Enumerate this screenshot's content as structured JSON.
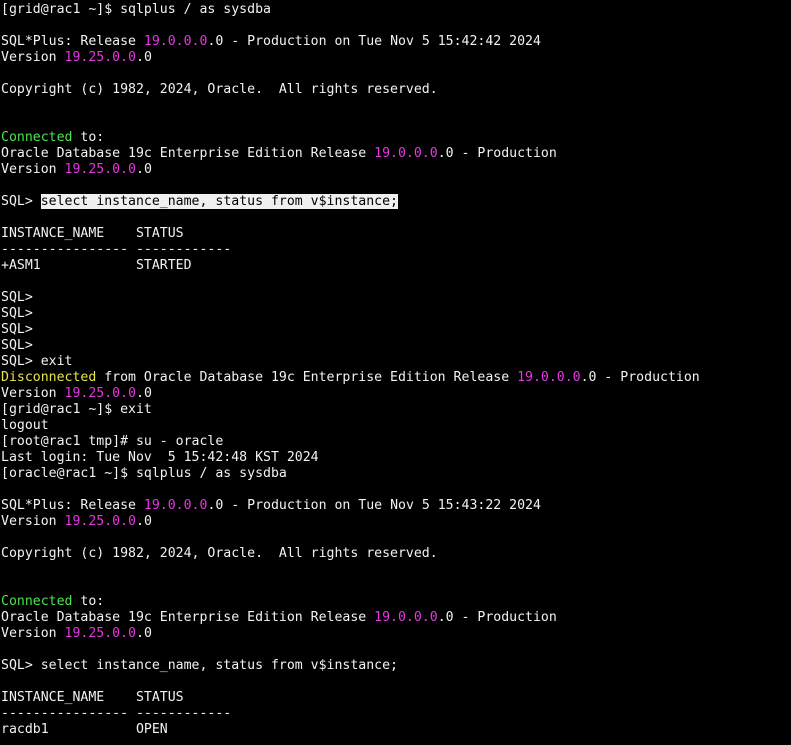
{
  "colors": {
    "background": "#000000",
    "foreground": "#f2f2f2",
    "number": "#e535e5",
    "connected": "#4fe34f",
    "disconnected": "#e6e64a",
    "selection_bg": "#f0f0f0",
    "selection_fg": "#000000"
  },
  "terminal": {
    "lines": [
      [
        {
          "t": "[grid@rac1 ~]$ sqlplus / as sysdba"
        }
      ],
      [],
      [
        {
          "t": "SQL*Plus: Release "
        },
        {
          "t": "19.0.0.0",
          "c": "number"
        },
        {
          "t": ".0 - Production on Tue Nov 5 15:42:42 2024"
        }
      ],
      [
        {
          "t": "Version "
        },
        {
          "t": "19.25.0.0",
          "c": "number"
        },
        {
          "t": ".0"
        }
      ],
      [],
      [
        {
          "t": "Copyright (c) 1982, 2024, Oracle.  All rights reserved."
        }
      ],
      [],
      [],
      [
        {
          "t": "Connected",
          "c": "connected"
        },
        {
          "t": " to:"
        }
      ],
      [
        {
          "t": "Oracle Database 19c Enterprise Edition Release "
        },
        {
          "t": "19.0.0.0",
          "c": "number"
        },
        {
          "t": ".0 - Production"
        }
      ],
      [
        {
          "t": "Version "
        },
        {
          "t": "19.25.0.0",
          "c": "number"
        },
        {
          "t": ".0"
        }
      ],
      [],
      [
        {
          "t": "SQL> "
        },
        {
          "t": "select instance_name, status from v$instance;",
          "c": "selected"
        }
      ],
      [],
      [
        {
          "t": "INSTANCE_NAME    STATUS"
        }
      ],
      [
        {
          "t": "---------------- ------------"
        }
      ],
      [
        {
          "t": "+ASM1            STARTED"
        }
      ],
      [],
      [
        {
          "t": "SQL>"
        }
      ],
      [
        {
          "t": "SQL>"
        }
      ],
      [
        {
          "t": "SQL>"
        }
      ],
      [
        {
          "t": "SQL>"
        }
      ],
      [
        {
          "t": "SQL> exit"
        }
      ],
      [
        {
          "t": "Disconnected",
          "c": "disconnected"
        },
        {
          "t": " from Oracle Database 19c Enterprise Edition Release "
        },
        {
          "t": "19.0.0.0",
          "c": "number"
        },
        {
          "t": ".0 - Production"
        }
      ],
      [
        {
          "t": "Version "
        },
        {
          "t": "19.25.0.0",
          "c": "number"
        },
        {
          "t": ".0"
        }
      ],
      [
        {
          "t": "[grid@rac1 ~]$ exit"
        }
      ],
      [
        {
          "t": "logout"
        }
      ],
      [
        {
          "t": "[root@rac1 tmp]# su - oracle"
        }
      ],
      [
        {
          "t": "Last login: Tue Nov  5 15:42:48 KST 2024"
        }
      ],
      [
        {
          "t": "[oracle@rac1 ~]$ sqlplus / as sysdba"
        }
      ],
      [],
      [
        {
          "t": "SQL*Plus: Release "
        },
        {
          "t": "19.0.0.0",
          "c": "number"
        },
        {
          "t": ".0 - Production on Tue Nov 5 15:43:22 2024"
        }
      ],
      [
        {
          "t": "Version "
        },
        {
          "t": "19.25.0.0",
          "c": "number"
        },
        {
          "t": ".0"
        }
      ],
      [],
      [
        {
          "t": "Copyright (c) 1982, 2024, Oracle.  All rights reserved."
        }
      ],
      [],
      [],
      [
        {
          "t": "Connected",
          "c": "connected"
        },
        {
          "t": " to:"
        }
      ],
      [
        {
          "t": "Oracle Database 19c Enterprise Edition Release "
        },
        {
          "t": "19.0.0.0",
          "c": "number"
        },
        {
          "t": ".0 - Production"
        }
      ],
      [
        {
          "t": "Version "
        },
        {
          "t": "19.25.0.0",
          "c": "number"
        },
        {
          "t": ".0"
        }
      ],
      [],
      [
        {
          "t": "SQL> select instance_name, status from v$instance;"
        }
      ],
      [],
      [
        {
          "t": "INSTANCE_NAME    STATUS"
        }
      ],
      [
        {
          "t": "---------------- ------------"
        }
      ],
      [
        {
          "t": "racdb1           OPEN"
        }
      ]
    ]
  }
}
